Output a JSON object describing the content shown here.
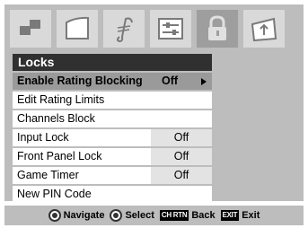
{
  "icons": [
    {
      "name": "picture-icon",
      "active": false
    },
    {
      "name": "display-icon",
      "active": false
    },
    {
      "name": "audio-note-icon",
      "active": false
    },
    {
      "name": "setup-icon",
      "active": false
    },
    {
      "name": "lock-icon",
      "active": true
    },
    {
      "name": "application-icon",
      "active": false
    }
  ],
  "menu": {
    "title": "Locks",
    "items": [
      {
        "label": "Enable Rating Blocking",
        "value": "Off",
        "selected": true
      },
      {
        "label": "Edit Rating Limits",
        "value": ""
      },
      {
        "label": "Channels Block",
        "value": ""
      },
      {
        "label": "Input Lock",
        "value": "Off"
      },
      {
        "label": "Front Panel Lock",
        "value": "Off"
      },
      {
        "label": "Game Timer",
        "value": "Off"
      },
      {
        "label": "New PIN Code",
        "value": ""
      }
    ]
  },
  "footer": {
    "navigate_label": "Navigate",
    "select_label": "Select",
    "back_key": "CH RTN",
    "back_label": "Back",
    "exit_key": "EXIT",
    "exit_label": "Exit"
  },
  "colors": {
    "panel_bg": "#bdbdbd",
    "title_bg": "#303030",
    "selected_row": "#9a9a9a",
    "value_cell": "#e3e3e3"
  }
}
